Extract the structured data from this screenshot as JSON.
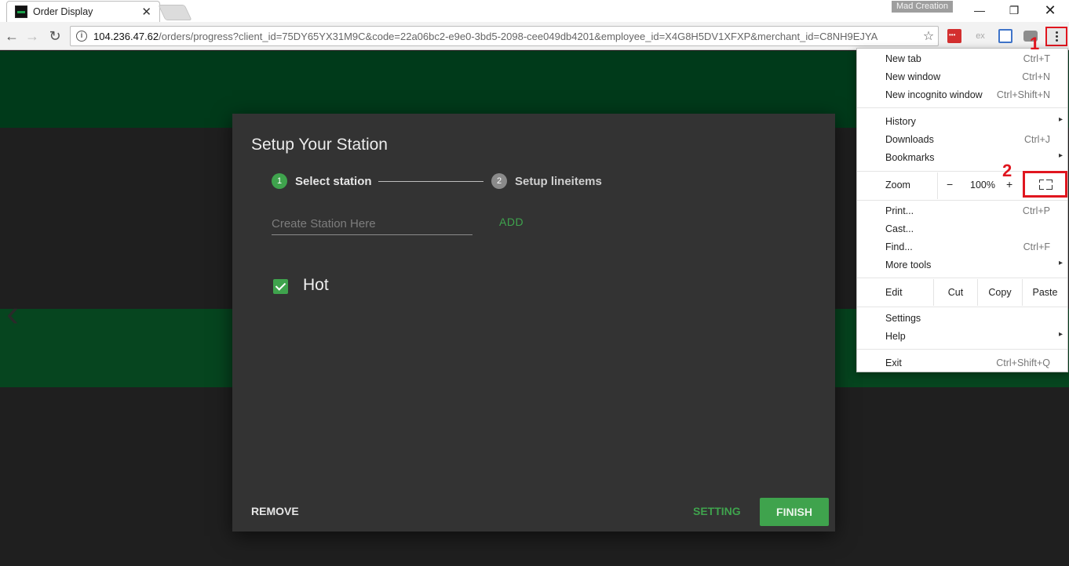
{
  "browser": {
    "tab_title": "Order Display",
    "tab_close": "✕",
    "profile_label": "Mad Creation",
    "window_buttons": {
      "minimize": "—",
      "maximize": "❐",
      "close": "✕"
    },
    "nav": {
      "back": "←",
      "forward": "→",
      "reload": "↻"
    },
    "url_host": "104.236.47.62",
    "url_path": "/orders/progress?client_id=75DY65YX31M9C&code=22a06bc2-e9e0-3bd5-2098-cee049db4201&employee_id=X4G8H5DV1XFXP&merchant_id=C8NH9EJYA",
    "info_symbol": "i",
    "star_symbol": "☆",
    "extension_2_label": "ex"
  },
  "dialog": {
    "title": "Setup Your Station",
    "steps": [
      {
        "number": "1",
        "label": "Select station",
        "state": "active"
      },
      {
        "number": "2",
        "label": "Setup lineitems",
        "state": "inactive"
      }
    ],
    "station_input": {
      "placeholder": "Create Station Here",
      "value": ""
    },
    "add_label": "ADD",
    "stations": [
      {
        "label": "Hot",
        "checked": true
      }
    ],
    "remove_label": "REMOVE",
    "setting_label": "SETTING",
    "finish_label": "FINISH",
    "accent_color": "#3fa34d"
  },
  "chrome_menu": {
    "group1": [
      {
        "label": "New tab",
        "shortcut": "Ctrl+T"
      },
      {
        "label": "New window",
        "shortcut": "Ctrl+N"
      },
      {
        "label": "New incognito window",
        "shortcut": "Ctrl+Shift+N"
      }
    ],
    "group2": [
      {
        "label": "History",
        "submenu": "▸"
      },
      {
        "label": "Downloads",
        "shortcut": "Ctrl+J"
      },
      {
        "label": "Bookmarks",
        "submenu": "▸"
      }
    ],
    "zoom": {
      "label": "Zoom",
      "minus": "−",
      "value": "100%",
      "plus": "+",
      "fullscreen_icon": "fullscreen-icon"
    },
    "group3": [
      {
        "label": "Print...",
        "shortcut": "Ctrl+P"
      },
      {
        "label": "Cast..."
      },
      {
        "label": "Find...",
        "shortcut": "Ctrl+F"
      },
      {
        "label": "More tools",
        "submenu": "▸"
      }
    ],
    "edit": {
      "label": "Edit",
      "cut": "Cut",
      "copy": "Copy",
      "paste": "Paste"
    },
    "group4": [
      {
        "label": "Settings"
      },
      {
        "label": "Help",
        "submenu": "▸"
      }
    ],
    "exit": {
      "label": "Exit",
      "shortcut": "Ctrl+Shift+Q"
    }
  },
  "annotations": {
    "marker_1": "1",
    "marker_2": "2",
    "marker_color": "#e0161f"
  },
  "page_background": {
    "ghost_arrow": "‹"
  }
}
